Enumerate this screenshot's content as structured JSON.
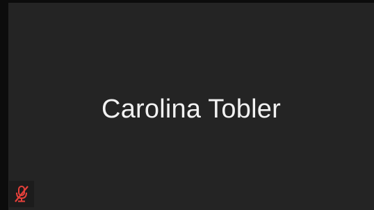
{
  "tile": {
    "participant_name": "Carolina Tobler",
    "audio_status": "muted",
    "audio_icon": "microphone-muted-icon"
  },
  "colors": {
    "tile_background": "#242424",
    "frame_background": "#0c0c0c",
    "name_text": "#f2f2f2",
    "muted_icon": "#e5403a"
  }
}
